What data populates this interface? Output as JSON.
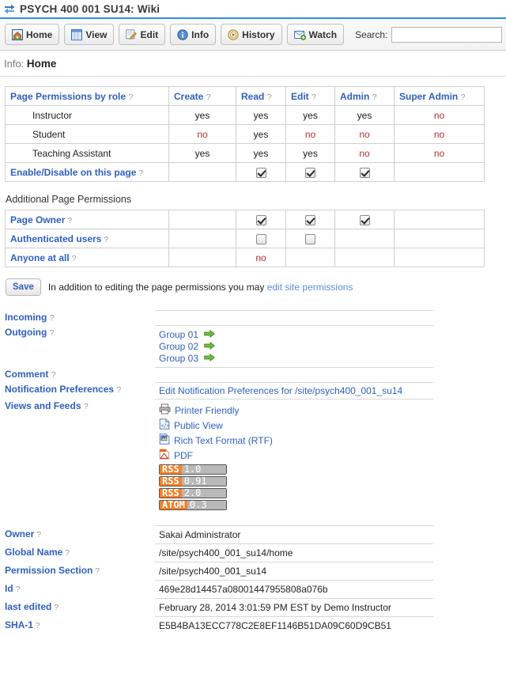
{
  "window": {
    "title": "PSYCH 400 001 SU14: Wiki",
    "title_icon": "swap-arrows-icon"
  },
  "toolbar": {
    "buttons": [
      {
        "label": "Home",
        "icon": "home-icon"
      },
      {
        "label": "View",
        "icon": "table-view-icon"
      },
      {
        "label": "Edit",
        "icon": "pencil-edit-icon"
      },
      {
        "label": "Info",
        "icon": "info-circle-icon"
      },
      {
        "label": "History",
        "icon": "history-clock-icon"
      },
      {
        "label": "Watch",
        "icon": "envelope-watch-icon"
      }
    ],
    "search_label": "Search:",
    "search_value": "",
    "search_placeholder": ""
  },
  "page_heading": {
    "prefix": "Info:",
    "name": "Home"
  },
  "permissions": {
    "headers": [
      "Page Permissions by role",
      "Create",
      "Read",
      "Edit",
      "Admin",
      "Super Admin"
    ],
    "rows": [
      {
        "role": "Instructor",
        "values": [
          "yes",
          "yes",
          "yes",
          "yes",
          "no"
        ]
      },
      {
        "role": "Student",
        "values": [
          "no",
          "yes",
          "no",
          "no",
          "no"
        ]
      },
      {
        "role": "Teaching Assistant",
        "values": [
          "yes",
          "yes",
          "yes",
          "no",
          "no"
        ]
      }
    ],
    "enable_row_label": "Enable/Disable on this page",
    "enable_row_checks": [
      null,
      true,
      true,
      true,
      null
    ]
  },
  "additional_permissions": {
    "title": "Additional Page Permissions",
    "rows": [
      {
        "label": "Page Owner",
        "checks": [
          null,
          true,
          true,
          true,
          null
        ],
        "text": [
          null,
          null,
          null,
          null,
          null
        ]
      },
      {
        "label": "Authenticated users",
        "checks": [
          null,
          false,
          false,
          null,
          null
        ],
        "text": [
          null,
          null,
          null,
          null,
          null
        ]
      },
      {
        "label": "Anyone at all",
        "checks": [
          null,
          null,
          null,
          null,
          null
        ],
        "text": [
          null,
          "no",
          null,
          null,
          null
        ]
      }
    ]
  },
  "save_row": {
    "button_label": "Save",
    "note_text": "In addition to editing the page permissions you may ",
    "note_link": "edit site permissions"
  },
  "details": {
    "incoming_label": "Incoming",
    "incoming_value": "",
    "outgoing_label": "Outgoing",
    "outgoing_groups": [
      "Group 01",
      "Group 02",
      "Group 03"
    ],
    "comment_label": "Comment",
    "comment_value": "",
    "notification_label": "Notification Preferences",
    "notification_link": "Edit Notification Preferences for /site/psych400_001_su14",
    "views_label": "Views and Feeds",
    "views": [
      {
        "label": "Printer Friendly",
        "icon": "printer-icon"
      },
      {
        "label": "Public View",
        "icon": "code-document-icon"
      },
      {
        "label": "Rich Text Format (RTF)",
        "icon": "rtf-document-icon"
      },
      {
        "label": "PDF",
        "icon": "pdf-document-icon"
      }
    ],
    "feeds": [
      {
        "kind": "RSS",
        "version": "1.0"
      },
      {
        "kind": "RSS",
        "version": "0.91"
      },
      {
        "kind": "RSS",
        "version": "2.0"
      },
      {
        "kind": "ATOM",
        "version": "0.3"
      }
    ]
  },
  "metadata": [
    {
      "label": "Owner",
      "value": "Sakai Administrator"
    },
    {
      "label": "Global Name",
      "value": "/site/psych400_001_su14/home"
    },
    {
      "label": "Permission Section",
      "value": "/site/psych400_001_su14"
    },
    {
      "label": "Id",
      "value": "469e28d14457a08001447955808a076b"
    },
    {
      "label": "last edited",
      "value": "February 28, 2014 3:01:59 PM EST by Demo Instructor"
    },
    {
      "label": "SHA-1",
      "value": "E5B4BA13ECC778C2E8EF1146B51DA09C60D9CB51"
    }
  ],
  "symbols": {
    "help": "?",
    "arrow_right": "➡"
  },
  "colors": {
    "link": "#2f5fbf",
    "rule": "#2e8fd4",
    "no": "#b03030",
    "rss_orange": "#f58025",
    "group_arrow_green": "#4e9a26"
  }
}
